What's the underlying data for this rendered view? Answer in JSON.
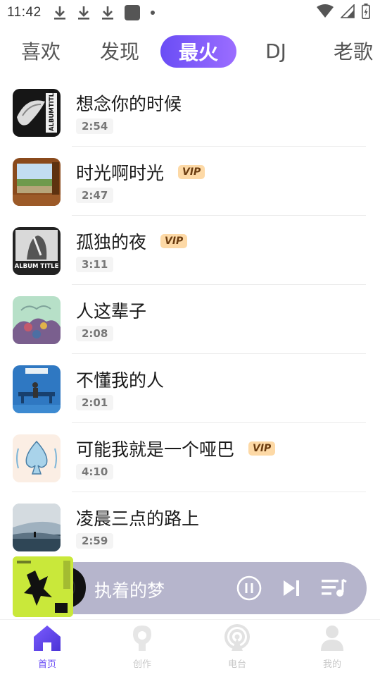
{
  "status_bar": {
    "time": "11:42"
  },
  "tabs": [
    {
      "label": "喜欢",
      "active": false
    },
    {
      "label": "发现",
      "active": false
    },
    {
      "label": "最火",
      "active": true
    },
    {
      "label": "DJ",
      "active": false
    },
    {
      "label": "老歌",
      "active": false
    }
  ],
  "songs": [
    {
      "title": "想念你的时候",
      "duration": "2:54",
      "vip": false,
      "cover_text": "ALBUM TITLE"
    },
    {
      "title": "时光啊时光",
      "duration": "2:47",
      "vip": true,
      "vip_label": "VIP"
    },
    {
      "title": "孤独的夜",
      "duration": "3:11",
      "vip": true,
      "vip_label": "VIP",
      "cover_text": "ALBUM TITLE"
    },
    {
      "title": "人这辈子",
      "duration": "2:08",
      "vip": false
    },
    {
      "title": "不懂我的人",
      "duration": "2:01",
      "vip": false
    },
    {
      "title": "可能我就是一个哑巴",
      "duration": "4:10",
      "vip": true,
      "vip_label": "VIP"
    },
    {
      "title": "凌晨三点的路上",
      "duration": "2:59",
      "vip": false
    }
  ],
  "player": {
    "now_playing": "执着的梦",
    "state": "playing"
  },
  "bottom_nav": [
    {
      "label": "首页",
      "icon": "home-icon",
      "active": true
    },
    {
      "label": "创作",
      "icon": "create-icon",
      "active": false
    },
    {
      "label": "电台",
      "icon": "radio-icon",
      "active": false
    },
    {
      "label": "我的",
      "icon": "profile-icon",
      "active": false
    }
  ],
  "colors": {
    "accent": "#6a4df5",
    "vip_bg": "#fdd9a6",
    "player_bg": "#b6b5cc"
  }
}
